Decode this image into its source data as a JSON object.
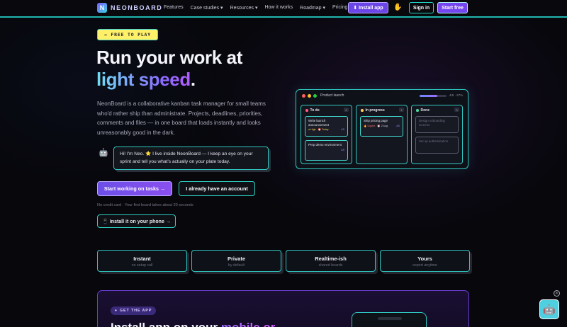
{
  "nav": {
    "logo_mark": "N",
    "logo_text": "NEONBOARD",
    "links": [
      "Features",
      "Case studies ▾",
      "Resources ▾",
      "How it works",
      "Roadmap ▾",
      "Pricing"
    ],
    "install_label": "⬇ Install app",
    "signin_label": "Sign in",
    "start_label": "Start free"
  },
  "hero": {
    "badge": "→ FREE TO PLAY",
    "title_line1": "Run your work at",
    "title_accent": "light speed",
    "title_end": ".",
    "lead": "NeonBoard is a collaborative kanban task manager for small teams who'd rather ship than administrate. Projects, deadlines, priorities, comments and files — in one board that loads instantly and looks unreasonably good in the dark.",
    "bubble": "Hi! I'm Neo. ⭐ I live inside NeonBoard — I keep an eye on your sprint and tell you what's actually on your plate today.",
    "cta_primary": "Start working on tasks →",
    "cta_secondary": "I already have an account",
    "microcopy": "No credit card · Your first board takes about 20 seconds",
    "phone_button": "📱 Install it on your phone →"
  },
  "board": {
    "title": "Product launch",
    "progress_text": "4/6 · 67%",
    "progress": 0.67,
    "columns": [
      {
        "name": "To do",
        "count": "2",
        "color": "#ff5c7a",
        "cards": [
          {
            "title": "Write launch announcement",
            "tags": [
              "● High",
              "⏰ Today"
            ],
            "avatar": "AS"
          },
          {
            "title": "Prep demo environment",
            "tags": [],
            "avatar": "AS"
          }
        ]
      },
      {
        "name": "In progress",
        "count": "1",
        "color": "#ffcf5a",
        "cards": [
          {
            "title": "Ship pricing page",
            "tags": [
              "🔥 Urgent",
              "⏰ 2 Aug"
            ],
            "avatar": "AS"
          }
        ]
      },
      {
        "name": "Done",
        "count": "3",
        "color": "#4fd6a0",
        "cards": [
          {
            "title": "Design onboarding screens",
            "tags": [],
            "avatar": ""
          },
          {
            "title": "Set up authentication",
            "tags": [],
            "avatar": ""
          }
        ]
      }
    ]
  },
  "features": [
    {
      "title": "Instant",
      "sub": "no setup call"
    },
    {
      "title": "Private",
      "sub": "by default"
    },
    {
      "title": "Realtime-ish",
      "sub": "shared boards"
    },
    {
      "title": "Yours",
      "sub": "export anytime"
    }
  ],
  "promo": {
    "badge": "GET THE APP",
    "title_start": "Install app on your ",
    "title_accent": "mobile or"
  },
  "colors": {
    "accent_teal": "#2fc7c0",
    "accent_purple": "#7546f0"
  }
}
